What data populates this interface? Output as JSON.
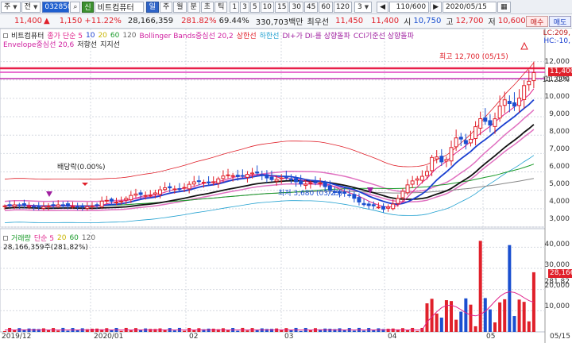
{
  "toolbar1": {
    "type_label": "주",
    "scope_label": "전",
    "code": "032850",
    "shin_label": "신",
    "stock_name": "비트컴퓨터",
    "periods": [
      "일",
      "주",
      "월",
      "분",
      "초",
      "틱"
    ],
    "active_period": "일",
    "nums": [
      "1",
      "3",
      "5",
      "10",
      "15",
      "30",
      "45",
      "60",
      "120"
    ],
    "count_value": "3",
    "range_value": "110/600",
    "date_value": "2020/05/15"
  },
  "quote": {
    "price": "11,400",
    "change": "1,150",
    "change_pct": "+11.22%",
    "volume": "28,166,359",
    "vol_ratio": "281.82%",
    "turnover": "69.44%",
    "amount": "330,703백만",
    "best_label": "최우선",
    "ask": "11,450",
    "bid": "11,400",
    "open_label": "시",
    "open": "10,750",
    "high_label": "고",
    "high": "12,700",
    "low_label": "저",
    "low": "10,600",
    "buy_label": "매수",
    "sell_label": "매도"
  },
  "price_legend": {
    "row1": [
      {
        "text": "비트컴퓨터",
        "color": "#222222"
      },
      {
        "text": "종가 단순 5",
        "color": "#e0208a"
      },
      {
        "text": "10",
        "color": "#1a3fd0"
      },
      {
        "text": "20",
        "color": "#c8b400"
      },
      {
        "text": "60",
        "color": "#1a9a2a"
      },
      {
        "text": "120",
        "color": "#666666"
      },
      {
        "text": "Bollinger Bands중심선 20,2",
        "color": "#d020a0"
      },
      {
        "text": "상한선",
        "color": "#e0202a"
      },
      {
        "text": "하한선",
        "color": "#20a0d0"
      },
      {
        "text": "DI+가 DI-를 상향돌파",
        "color": "#a020a0"
      },
      {
        "text": "CCI기준선 상향돌파",
        "color": "#a020a0"
      }
    ],
    "row2": [
      {
        "text": "Envelope중심선 20,6",
        "color": "#d020a0"
      },
      {
        "text": "저항선",
        "color": "#222222"
      },
      {
        "text": "지지선",
        "color": "#222222"
      }
    ]
  },
  "volume_legend": {
    "items": [
      {
        "text": "거래량",
        "color": "#1a9a2a"
      },
      {
        "text": "단순 5",
        "color": "#e0208a"
      },
      {
        "text": "20",
        "color": "#c8b400"
      },
      {
        "text": "60",
        "color": "#1a9a2a"
      },
      {
        "text": "120",
        "color": "#666666"
      }
    ],
    "current": "28,166,359주(281,82%)"
  },
  "annotations": {
    "high": "최고 12,700 (05/15)",
    "low": "최저 3,680 (03/23)",
    "dividend": "배당락(0.00%)"
  },
  "right_axis": {
    "lc": "LC:209,",
    "hc": "HC:-10,",
    "price_ticks": [
      "12,000",
      "11,000",
      "10,000",
      "9,000",
      "8,000",
      "7,000",
      "6,000",
      "5,000",
      "4,000",
      "3,000"
    ],
    "current_tag": "11,400",
    "pct_tag": "11.22%",
    "volume_ticks": [
      "40,000",
      "30,000",
      "20,000",
      "10,000"
    ],
    "volume_tag": "28,166",
    "volume_pct_tag": "281.82"
  },
  "x_axis": [
    "2019/12",
    "2020/01",
    "02",
    "03",
    "04",
    "05",
    "05/15"
  ],
  "colors": {
    "up": "#e0202a",
    "down": "#1a4fd0",
    "ma5": "#e0208a",
    "ma10": "#1a3fd0",
    "ma20": "#c8b400",
    "ma60": "#1a9a2a",
    "ma120": "#666666"
  },
  "chart_data": [
    {
      "type": "candlestick",
      "title": "비트컴퓨터",
      "x_range": [
        "2019/12",
        "2020/05/15"
      ],
      "ylim": [
        3000,
        12500
      ],
      "y_ticks": [
        3000,
        4000,
        5000,
        6000,
        7000,
        8000,
        9000,
        10000,
        11000,
        12000
      ],
      "grid": true,
      "legend": "top-left",
      "points": {
        "high": {
          "date": "05/15",
          "value": 12700
        },
        "low": {
          "date": "03/23",
          "value": 3680
        },
        "last": {
          "date": "05/15",
          "value": 11400
        }
      },
      "series": [
        {
          "name": "종가 단순 5"
        },
        {
          "name": "10"
        },
        {
          "name": "20"
        },
        {
          "name": "60"
        },
        {
          "name": "120"
        }
      ]
    },
    {
      "type": "bar",
      "title": "거래량",
      "ylim": [
        0,
        45000
      ],
      "y_ticks": [
        10000,
        20000,
        30000,
        40000
      ],
      "grid": true,
      "legend": "top-left"
    }
  ]
}
